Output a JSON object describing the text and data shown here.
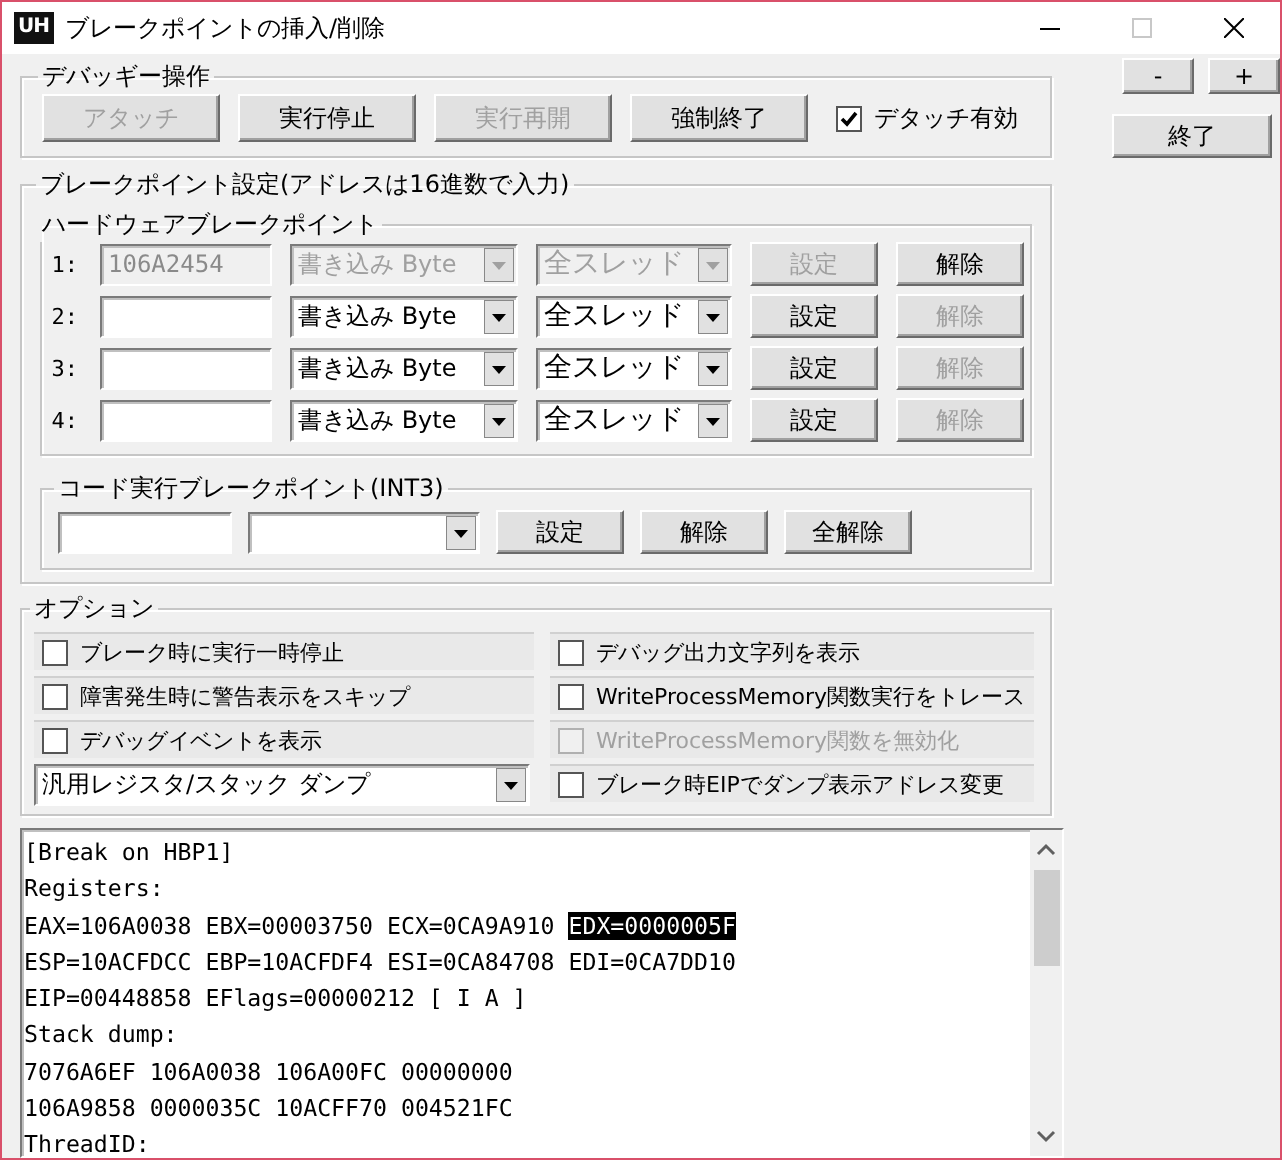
{
  "window": {
    "app_icon": "UH",
    "title": "ブレークポイントの挿入/削除"
  },
  "side_buttons": [
    {
      "label": "-",
      "kind": "small"
    },
    {
      "label": "+",
      "kind": "small"
    },
    {
      "label": "終了",
      "kind": "wide"
    }
  ],
  "debuggee": {
    "title": "デバッギー操作",
    "buttons": [
      {
        "label": "アタッチ",
        "disabled": true
      },
      {
        "label": "実行停止",
        "disabled": false
      },
      {
        "label": "実行再開",
        "disabled": true
      },
      {
        "label": "強制終了",
        "disabled": false
      }
    ],
    "detach": {
      "label": "デタッチ有効",
      "checked": true
    }
  },
  "breakpoints": {
    "title": "ブレークポイント設定(アドレスは16進数で入力)",
    "hardware": {
      "title": "ハードウェアブレークポイント",
      "rows": [
        {
          "index": "1:",
          "address": "106A2454",
          "access": "書き込み Byte",
          "thread": "全スレッド",
          "disabled": true,
          "set": {
            "label": "設定",
            "disabled": true
          },
          "clear": {
            "label": "解除",
            "disabled": false
          }
        },
        {
          "index": "2:",
          "access": "書き込み Byte",
          "thread": "全スレッド",
          "disabled": false,
          "set": {
            "label": "設定",
            "disabled": false
          },
          "clear": {
            "label": "解除",
            "disabled": true
          }
        },
        {
          "index": "3:",
          "access": "書き込み Byte",
          "thread": "全スレッド",
          "disabled": false,
          "set": {
            "label": "設定",
            "disabled": false
          },
          "clear": {
            "label": "解除",
            "disabled": true
          }
        },
        {
          "index": "4:",
          "access": "書き込み Byte",
          "thread": "全スレッド",
          "disabled": false,
          "set": {
            "label": "設定",
            "disabled": false
          },
          "clear": {
            "label": "解除",
            "disabled": true
          }
        }
      ]
    },
    "int3": {
      "title": "コード実行ブレークポイント(INT3)",
      "buttons": [
        {
          "label": "設定"
        },
        {
          "label": "解除"
        },
        {
          "label": "全解除"
        }
      ]
    }
  },
  "options": {
    "title": "オプション",
    "items": [
      {
        "kind": "checkbox",
        "label": "ブレーク時に実行一時停止",
        "checked": false,
        "disabled": false
      },
      {
        "kind": "checkbox",
        "label": "デバッグ出力文字列を表示",
        "checked": false,
        "disabled": false
      },
      {
        "kind": "checkbox",
        "label": "障害発生時に警告表示をスキップ",
        "checked": false,
        "disabled": false
      },
      {
        "kind": "checkbox",
        "label": "WriteProcessMemory関数実行をトレース",
        "checked": false,
        "disabled": false
      },
      {
        "kind": "checkbox",
        "label": "デバッグイベントを表示",
        "checked": false,
        "disabled": false
      },
      {
        "kind": "checkbox",
        "label": "WriteProcessMemory関数を無効化",
        "checked": false,
        "disabled": true
      },
      {
        "kind": "select",
        "label": "汎用レジスタ/スタック ダンプ"
      },
      {
        "kind": "checkbox",
        "label": "ブレーク時EIPでダンプ表示アドレス変更",
        "checked": false,
        "disabled": false
      }
    ]
  },
  "log": [
    [
      {
        "text": "[Break on HBP1]",
        "selected": false
      }
    ],
    [
      {
        "text": "Registers:",
        "selected": false
      }
    ],
    [
      {
        "text": "EAX=106A0038 EBX=00003750 ECX=0CA9A910 ",
        "selected": false
      },
      {
        "text": "EDX=0000005F",
        "selected": true
      }
    ],
    [
      {
        "text": "ESP=10ACFDCC EBP=10ACFDF4 ESI=0CA84708 EDI=0CA7DD10",
        "selected": false
      }
    ],
    [
      {
        "text": "EIP=00448858 EFlags=00000212 [ I A ]",
        "selected": false
      }
    ],
    [
      {
        "text": "Stack dump:",
        "selected": false
      }
    ],
    [
      {
        "text": "7076A6EF 106A0038 106A00FC 00000000",
        "selected": false
      }
    ],
    [
      {
        "text": "106A9858 0000035C 10ACFF70 004521FC",
        "selected": false
      }
    ],
    [
      {
        "text": "ThreadID:",
        "selected": false
      }
    ]
  ]
}
